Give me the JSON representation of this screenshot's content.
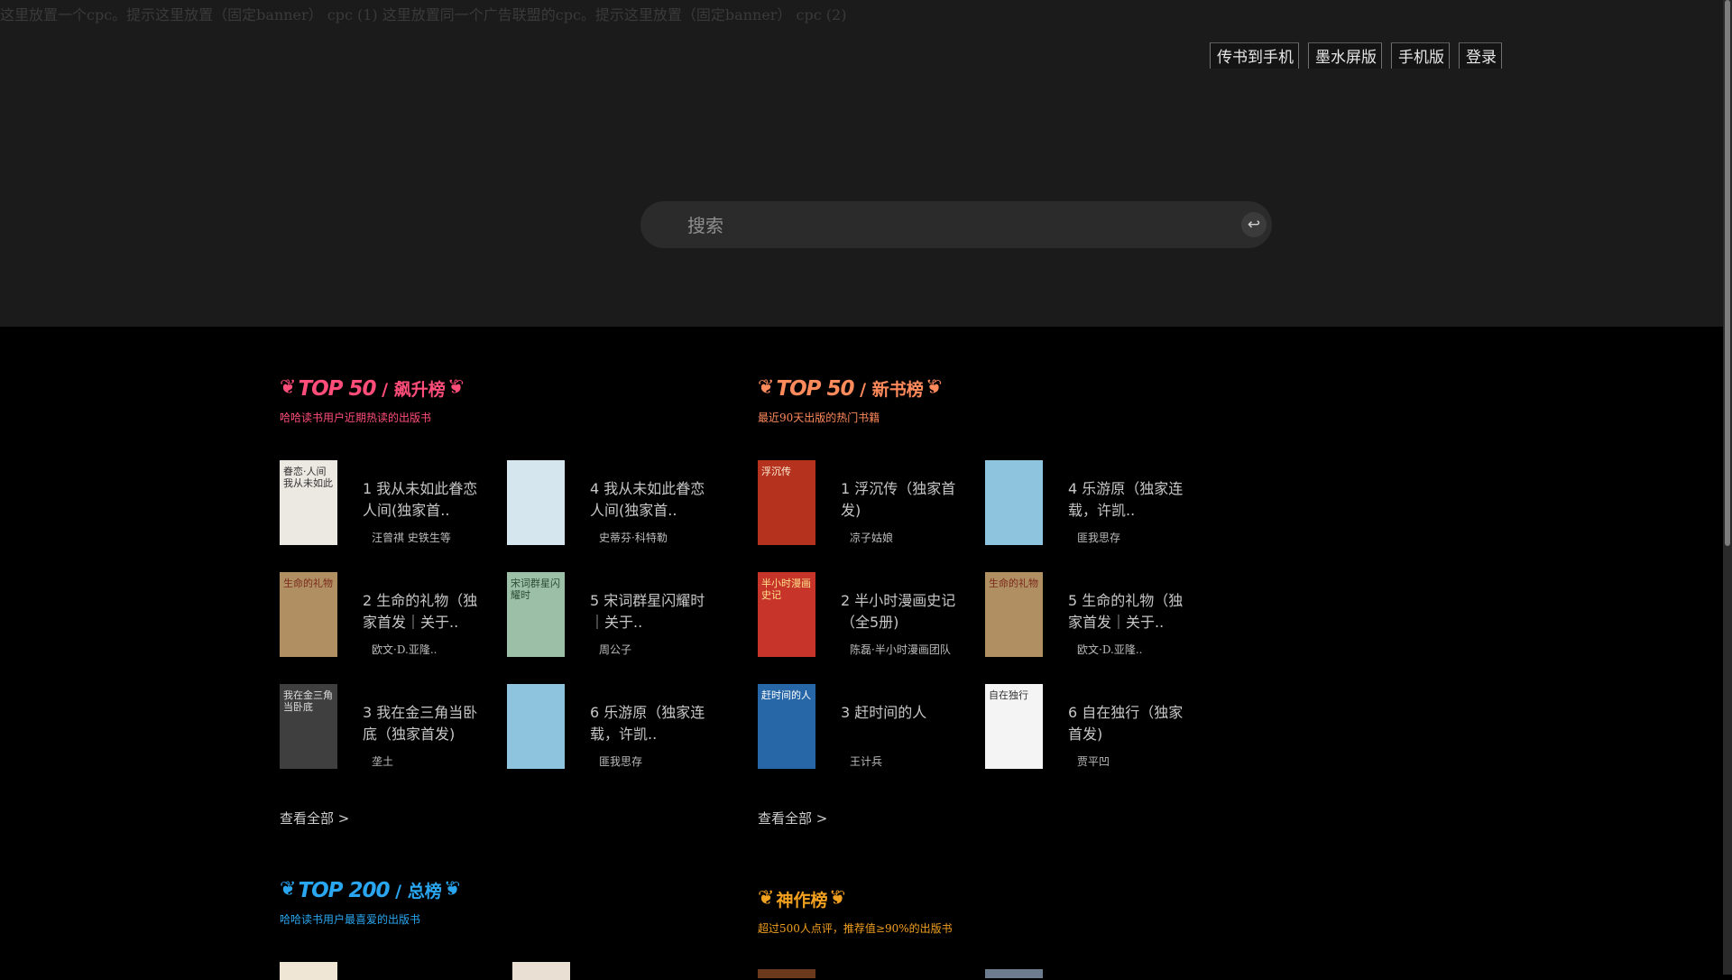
{
  "ad_banner": "这里放置一个cpc。提示这里放置（固定banner） cpc (1) 这里放置同一个广告联盟的cpc。提示这里放置（固定banner） cpc (2)",
  "nav": [
    "传书到手机",
    "墨水屏版",
    "手机版",
    "登录"
  ],
  "search": {
    "placeholder": "搜索",
    "enter_icon": "↩"
  },
  "colors": {
    "rise": "#ff4d79",
    "new": "#ff8a5c",
    "total": "#2aa6f0",
    "god": "#f2a01f",
    "page_bg": "#000000",
    "banner_bg": "#1b1b1b"
  },
  "sections": {
    "rise": {
      "title_big": "TOP 50",
      "title_small": "飙升榜",
      "subtitle": "哈哈读书用户近期热读的出版书",
      "view_all": "查看全部 >",
      "books": [
        {
          "rank": "1",
          "title": "我从未如此眷恋人间(独家首..",
          "author": "汪曾祺 史铁生等",
          "cover_text": "眷恋·人间 我从未如此",
          "cover_bg": "#ece8e2",
          "cover_fg": "#333"
        },
        {
          "rank": "2",
          "title": "生命的礼物（独家首发｜关于..",
          "author": "欧文·D.亚隆..",
          "cover_text": "生命的礼物",
          "cover_bg": "#b08f62",
          "cover_fg": "#7a2a1c"
        },
        {
          "rank": "3",
          "title": "我在金三角当卧底（独家首发)",
          "author": "垄土",
          "cover_text": "我在金三角当卧底",
          "cover_bg": "#3f3f3f",
          "cover_fg": "#ddd"
        },
        {
          "rank": "4",
          "title": "我从未如此眷恋人间(独家首..",
          "author": "史蒂芬·科特勒",
          "cover_text": "",
          "cover_bg": "#d6e6ee",
          "cover_fg": "#2a5a7a"
        },
        {
          "rank": "5",
          "title": "宋词群星闪耀时｜关于..",
          "author": "周公子",
          "cover_text": "宋词群星闪耀时",
          "cover_bg": "#9cc0a7",
          "cover_fg": "#2c4a34"
        },
        {
          "rank": "6",
          "title": "乐游原（独家连载，许凯..",
          "author": "匪我思存",
          "cover_text": "",
          "cover_bg": "#8fc4de",
          "cover_fg": "#2c5a20"
        }
      ]
    },
    "new": {
      "title_big": "TOP 50",
      "title_small": "新书榜",
      "subtitle": "最近90天出版的热门书籍",
      "view_all": "查看全部 >",
      "books": [
        {
          "rank": "1",
          "title": "浮沉传（独家首发)",
          "author": "凉子姑娘",
          "cover_text": "浮沉传",
          "cover_bg": "#b5321f",
          "cover_fg": "#fff3d8"
        },
        {
          "rank": "2",
          "title": "半小时漫画史记（全5册)",
          "author": "陈磊·半小时漫画团队",
          "cover_text": "半小时漫画史记",
          "cover_bg": "#c7352a",
          "cover_fg": "#ffe08a"
        },
        {
          "rank": "3",
          "title": "赶时间的人",
          "author": "王计兵",
          "cover_text": "赶时间的人",
          "cover_bg": "#2767a8",
          "cover_fg": "#ffffff"
        },
        {
          "rank": "4",
          "title": "乐游原（独家连载，许凯..",
          "author": "匪我思存",
          "cover_text": "",
          "cover_bg": "#8fc4de",
          "cover_fg": "#2c5a20"
        },
        {
          "rank": "5",
          "title": "生命的礼物（独家首发｜关于..",
          "author": "欧文·D.亚隆..",
          "cover_text": "生命的礼物",
          "cover_bg": "#b08f62",
          "cover_fg": "#7a2a1c"
        },
        {
          "rank": "6",
          "title": "自在独行（独家首发)",
          "author": "贾平凹",
          "cover_text": "自在独行",
          "cover_bg": "#f4f4f4",
          "cover_fg": "#333"
        }
      ]
    },
    "total": {
      "title_big": "TOP 200",
      "title_small": "总榜",
      "subtitle": "哈哈读书用户最喜爱的出版书"
    },
    "god": {
      "title_small": "神作榜",
      "subtitle": "超过500人点评，推荐值≥90%的出版书"
    }
  }
}
